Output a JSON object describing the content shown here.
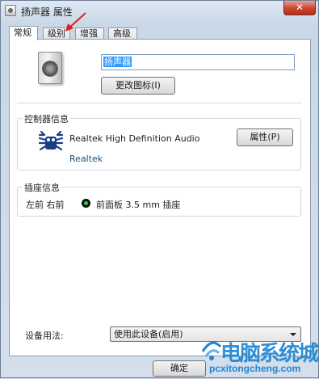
{
  "window": {
    "title": "扬声器 属性",
    "close_label": "✕"
  },
  "tabs": [
    {
      "label": "常规",
      "active": true
    },
    {
      "label": "级别",
      "active": false
    },
    {
      "label": "增强",
      "active": false
    },
    {
      "label": "高级",
      "active": false
    }
  ],
  "device": {
    "name_value": "扬声器",
    "change_icon_label": "更改图标(I)"
  },
  "controller": {
    "section_title": "控制器信息",
    "name": "Realtek High Definition Audio",
    "vendor": "Realtek",
    "properties_label": "属性(P)"
  },
  "jack": {
    "section_title": "插座信息",
    "channels": "左前 右前",
    "port": "前面板 3.5 mm 插座"
  },
  "usage": {
    "label": "设备用法:",
    "selected": "使用此设备(启用)"
  },
  "footer": {
    "ok_label": "确定"
  },
  "watermark": {
    "text": "电脑系统城",
    "url": "pcxitongcheng.com"
  },
  "colors": {
    "accent": "#3399ff",
    "jack_green": "#2bd42b",
    "annotation_red": "#e02020",
    "watermark_blue": "#1f86d2"
  }
}
